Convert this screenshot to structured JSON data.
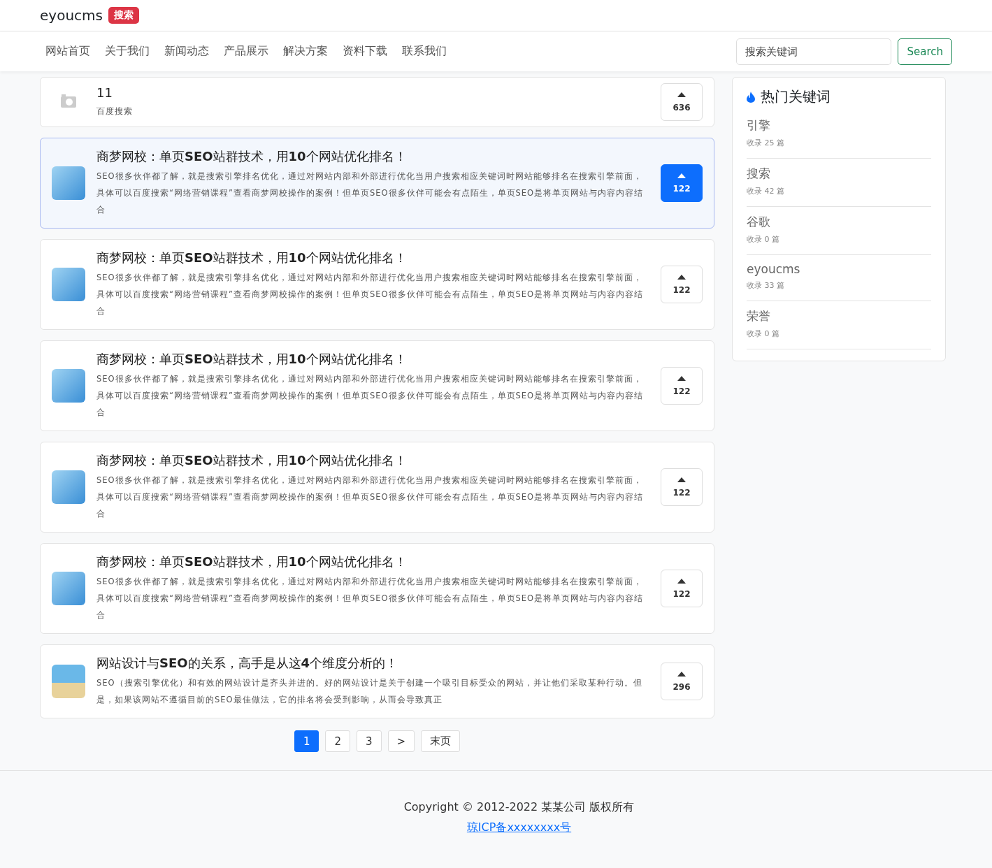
{
  "brand": {
    "name": "eyoucms",
    "badge": "搜索"
  },
  "nav": {
    "items": [
      "网站首页",
      "关于我们",
      "新闻动态",
      "产品展示",
      "解决方案",
      "资料下载",
      "联系我们"
    ],
    "search": {
      "placeholder": "搜索关键词",
      "button": "Search"
    }
  },
  "articles": [
    {
      "title": "11",
      "summary": "百度搜索",
      "votes": "636",
      "kind": "empty",
      "selected": false
    },
    {
      "title": "商梦网校：单页**SEO**站群技术，用**10**个网站优化排名！",
      "summary": "SEO很多伙伴都了解，就是搜索引擎排名优化，通过对网站内部和外部进行优化当用户搜索相应关键词时网站能够排名在搜索引擎前面，具体可以百度搜索“网络营销课程”查看商梦网校操作的案例！但单页SEO很多伙伴可能会有点陌生，单页SEO是将单页网站与内容内容结合",
      "votes": "122",
      "kind": "photo",
      "selected": true
    },
    {
      "title": "商梦网校：单页**SEO**站群技术，用**10**个网站优化排名！",
      "summary": "SEO很多伙伴都了解，就是搜索引擎排名优化，通过对网站内部和外部进行优化当用户搜索相应关键词时网站能够排名在搜索引擎前面，具体可以百度搜索“网络营销课程”查看商梦网校操作的案例！但单页SEO很多伙伴可能会有点陌生，单页SEO是将单页网站与内容内容结合",
      "votes": "122",
      "kind": "photo",
      "selected": false
    },
    {
      "title": "商梦网校：单页**SEO**站群技术，用**10**个网站优化排名！",
      "summary": "SEO很多伙伴都了解，就是搜索引擎排名优化，通过对网站内部和外部进行优化当用户搜索相应关键词时网站能够排名在搜索引擎前面，具体可以百度搜索“网络营销课程”查看商梦网校操作的案例！但单页SEO很多伙伴可能会有点陌生，单页SEO是将单页网站与内容内容结合",
      "votes": "122",
      "kind": "photo",
      "selected": false
    },
    {
      "title": "商梦网校：单页**SEO**站群技术，用**10**个网站优化排名！",
      "summary": "SEO很多伙伴都了解，就是搜索引擎排名优化，通过对网站内部和外部进行优化当用户搜索相应关键词时网站能够排名在搜索引擎前面，具体可以百度搜索“网络营销课程”查看商梦网校操作的案例！但单页SEO很多伙伴可能会有点陌生，单页SEO是将单页网站与内容内容结合",
      "votes": "122",
      "kind": "photo",
      "selected": false
    },
    {
      "title": "商梦网校：单页**SEO**站群技术，用**10**个网站优化排名！",
      "summary": "SEO很多伙伴都了解，就是搜索引擎排名优化，通过对网站内部和外部进行优化当用户搜索相应关键词时网站能够排名在搜索引擎前面，具体可以百度搜索“网络营销课程”查看商梦网校操作的案例！但单页SEO很多伙伴可能会有点陌生，单页SEO是将单页网站与内容内容结合",
      "votes": "122",
      "kind": "photo",
      "selected": false
    },
    {
      "title": "网站设计与**SEO**的关系，高手是从这**4**个维度分析的！",
      "summary": "SEO（搜索引擎优化）和有效的网站设计是齐头并进的。好的网站设计是关于创建一个吸引目标受众的网站，并让他们采取某种行动。但是，如果该网站不遵循目前的SEO最佳做法，它的排名将会受到影响，从而会导致真正",
      "votes": "296",
      "kind": "beach",
      "selected": false
    }
  ],
  "pagination": [
    {
      "label": "1",
      "selected": true
    },
    {
      "label": "2",
      "selected": false
    },
    {
      "label": "3",
      "selected": false
    },
    {
      "label": ">",
      "selected": false
    },
    {
      "label": "末页",
      "selected": false
    }
  ],
  "sidebar": {
    "title": "热门关键词",
    "keywords": [
      {
        "word": "引擎",
        "count": "收录 25 篇"
      },
      {
        "word": "搜索",
        "count": "收录 42 篇"
      },
      {
        "word": "谷歌",
        "count": "收录 0 篇"
      },
      {
        "word": "eyoucms",
        "count": "收录 33 篇"
      },
      {
        "word": "荣誉",
        "count": "收录 0 篇"
      }
    ]
  },
  "footer": {
    "copyright": "Copyright © 2012-2022 某某公司 版权所有",
    "icp": "琼ICP备xxxxxxxx号"
  }
}
